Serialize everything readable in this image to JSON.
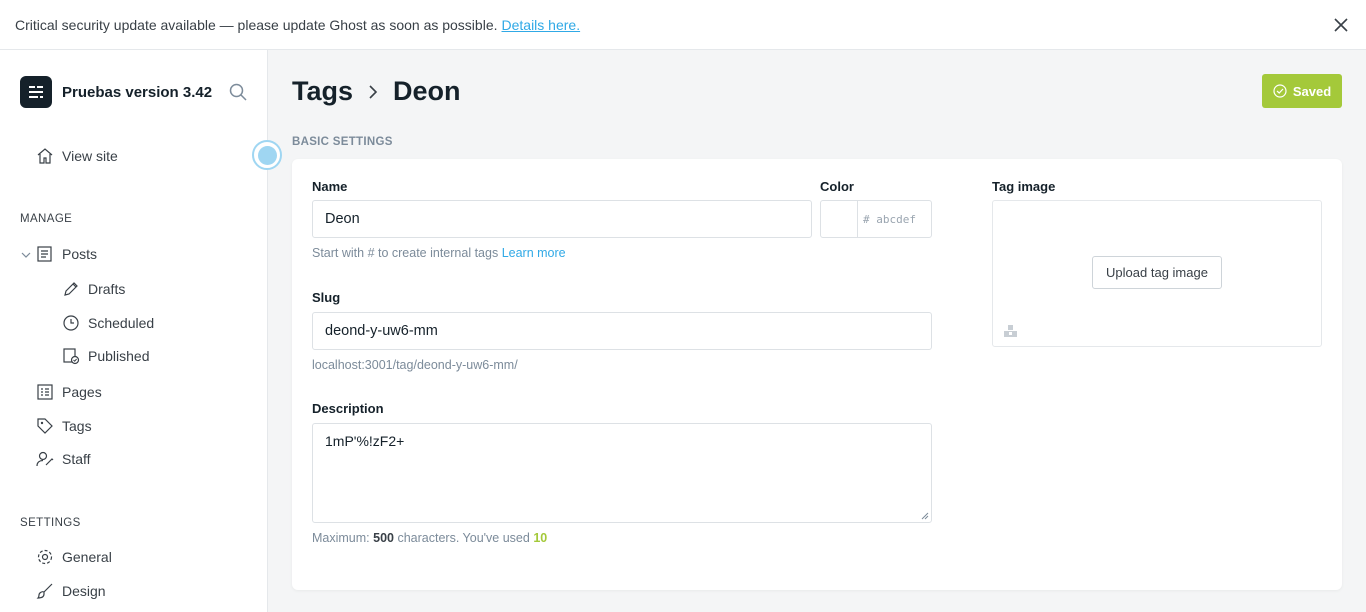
{
  "banner": {
    "message": "Critical security update available — please update Ghost as soon as possible.",
    "link": "Details here."
  },
  "sidebar": {
    "site_title": "Pruebas version 3.42",
    "view_site": "View site",
    "manage_heading": "MANAGE",
    "manage_items": [
      {
        "label": "Posts",
        "icon": "posts-icon"
      },
      {
        "label": "Drafts",
        "icon": "pencil-icon"
      },
      {
        "label": "Scheduled",
        "icon": "clock-icon"
      },
      {
        "label": "Published",
        "icon": "published-icon"
      },
      {
        "label": "Pages",
        "icon": "pages-icon"
      },
      {
        "label": "Tags",
        "icon": "tag-icon"
      },
      {
        "label": "Staff",
        "icon": "staff-icon"
      }
    ],
    "settings_heading": "SETTINGS",
    "settings_items": [
      {
        "label": "General",
        "icon": "gear-icon"
      },
      {
        "label": "Design",
        "icon": "brush-icon"
      }
    ]
  },
  "header": {
    "crumb_parent": "Tags",
    "crumb_current": "Deon",
    "save_label": "Saved"
  },
  "form": {
    "section_label": "BASIC SETTINGS",
    "name_label": "Name",
    "name_value": "Deon",
    "name_hint": "Start with # to create internal tags",
    "name_hint_link": "Learn more",
    "color_label": "Color",
    "color_hash": "#",
    "color_placeholder": "abcdef",
    "slug_label": "Slug",
    "slug_value": "deond-y-uw6-mm",
    "slug_url": "localhost:3001/tag/deond-y-uw6-mm/",
    "description_label": "Description",
    "description_value": "1mP'%!zF2+",
    "counter_prefix": "Maximum:",
    "counter_max": "500",
    "counter_middle": "characters. You've used",
    "counter_used": "10",
    "image_label": "Tag image",
    "upload_label": "Upload tag image"
  },
  "colors": {
    "accent_blue": "#30a9e6",
    "saved_green": "#a4c93a"
  }
}
